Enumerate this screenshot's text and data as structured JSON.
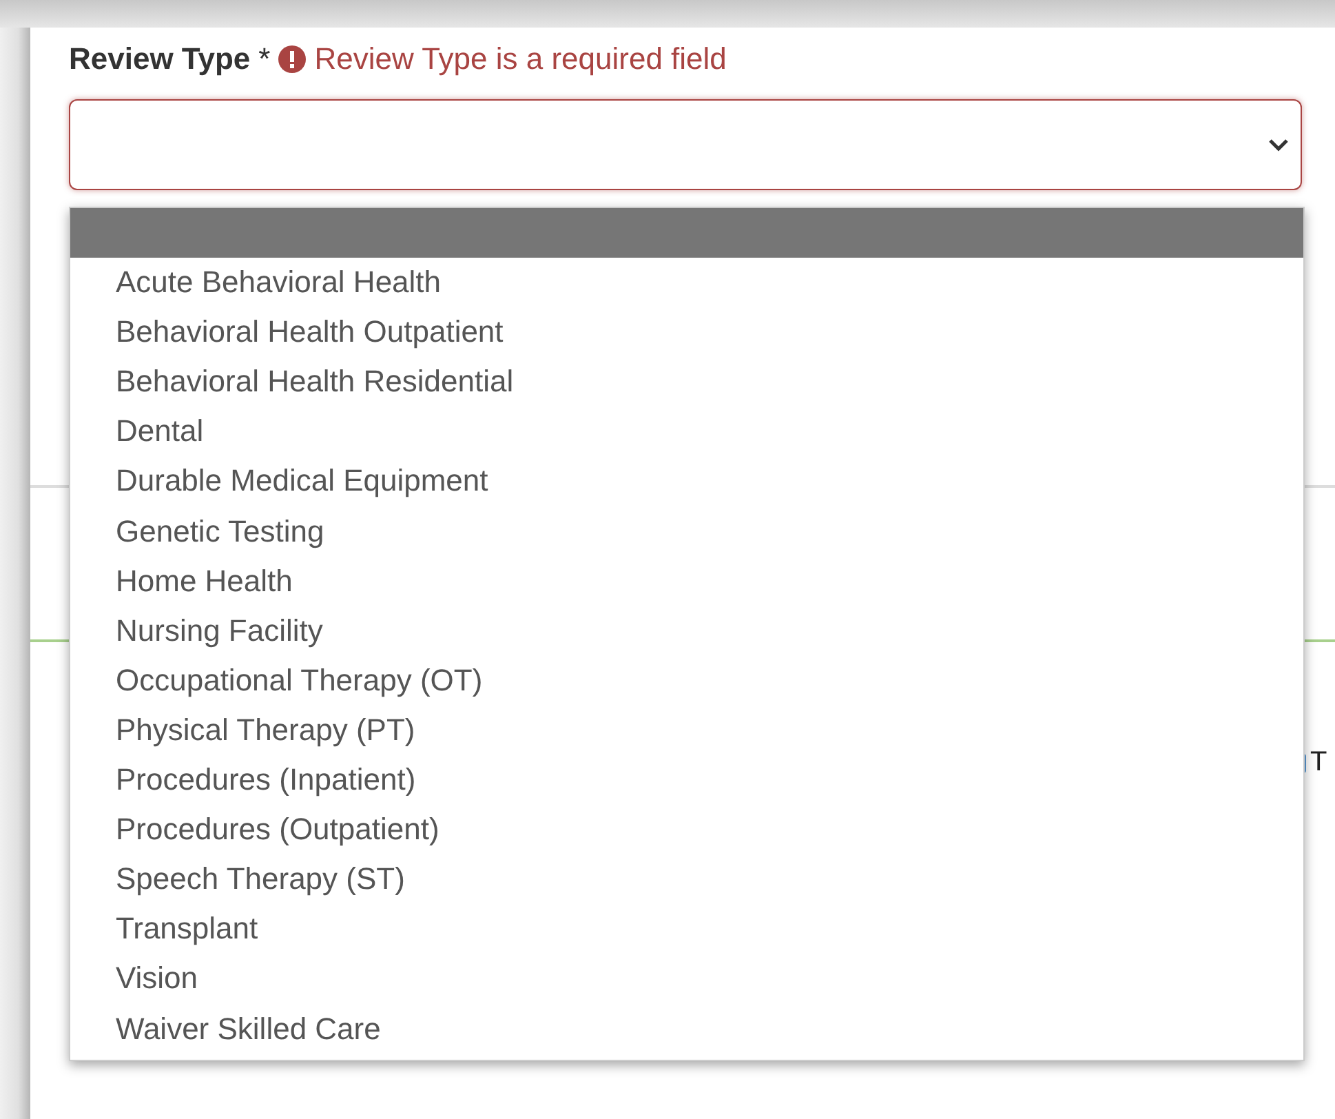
{
  "field": {
    "label": "Review Type",
    "required_mark": "*",
    "error": "Review Type is a required field",
    "invalid": true
  },
  "dropdown": {
    "expanded": true,
    "options": [
      {
        "selected": true
      },
      {
        "label": "Acute Behavioral Health",
        "selected": false
      },
      {
        "label": "Behavioral Health Outpatient",
        "selected": false
      },
      {
        "label": "Behavioral Health Residential",
        "selected": false
      },
      {
        "label": "Dental",
        "selected": false
      },
      {
        "label": "Durable Medical Equipment",
        "selected": false
      },
      {
        "label": "Genetic Testing",
        "selected": false
      },
      {
        "label": "Home Health",
        "selected": false
      },
      {
        "label": "Nursing Facility",
        "selected": false
      },
      {
        "label": "Occupational Therapy (OT)",
        "selected": false
      },
      {
        "label": "Physical Therapy (PT)",
        "selected": false
      },
      {
        "label": "Procedures (Inpatient)",
        "selected": false
      },
      {
        "label": "Procedures (Outpatient)",
        "selected": false
      },
      {
        "label": "Speech Therapy (ST)",
        "selected": false
      },
      {
        "label": "Transplant",
        "selected": false
      },
      {
        "label": "Vision",
        "selected": false
      },
      {
        "label": "Waiver Skilled Care",
        "selected": false
      }
    ]
  },
  "background_text": "T"
}
